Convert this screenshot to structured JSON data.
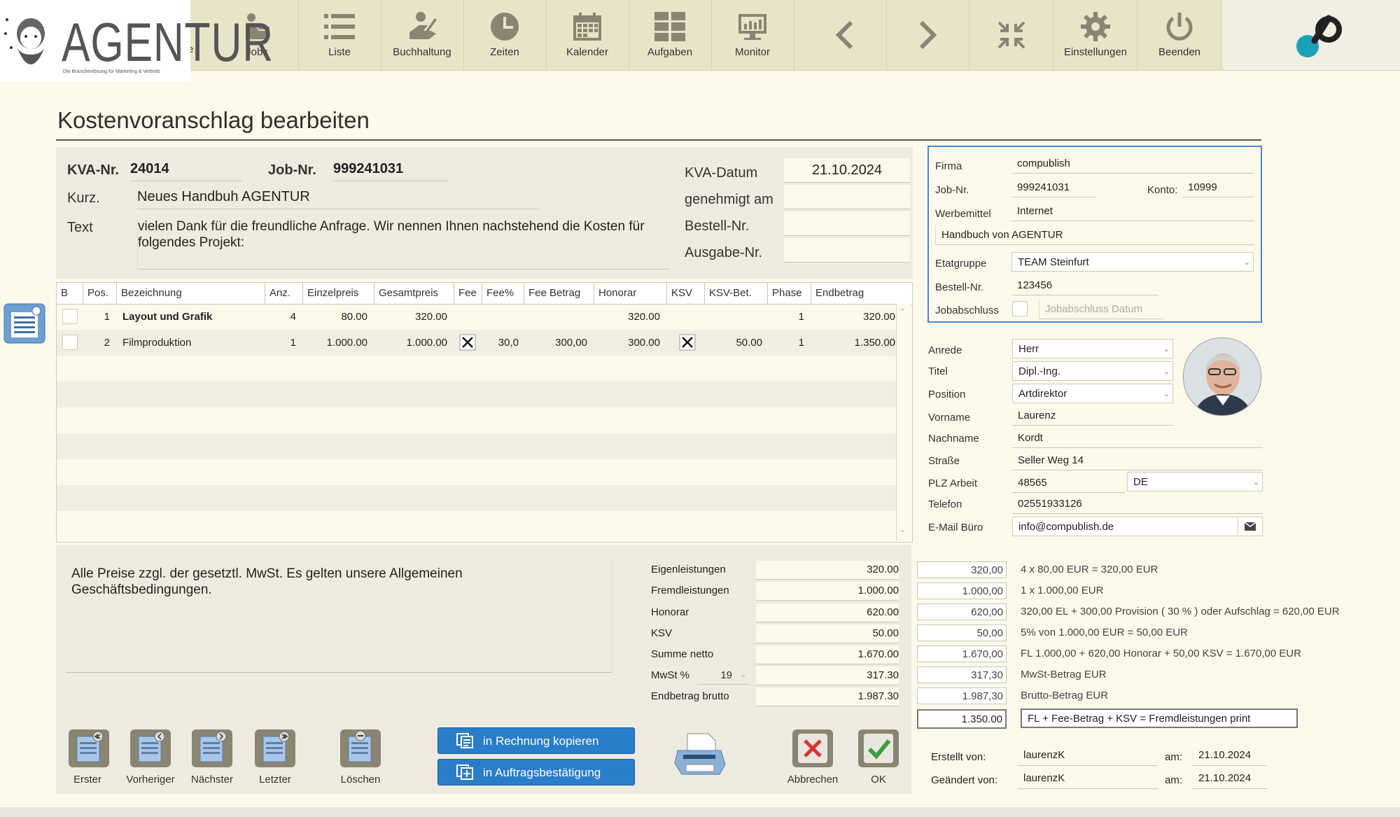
{
  "toolbar": {
    "items": [
      {
        "label": "Jobs",
        "icon": "person-desk-icon"
      },
      {
        "label": "Liste",
        "icon": "list-icon"
      },
      {
        "label": "Buchhaltung",
        "icon": "accounting-hand-icon"
      },
      {
        "label": "Zeiten",
        "icon": "clock-icon"
      },
      {
        "label": "Kalender",
        "icon": "calendar-icon"
      },
      {
        "label": "Aufgaben",
        "icon": "tasks-grid-icon"
      },
      {
        "label": "Monitor",
        "icon": "monitor-icon"
      },
      {
        "label": "",
        "icon": "chevron-left-icon"
      },
      {
        "label": "",
        "icon": "chevron-right-icon"
      },
      {
        "label": "",
        "icon": "collapse-icon"
      },
      {
        "label": "Einstellungen",
        "icon": "gear-icon"
      },
      {
        "label": "Beenden",
        "icon": "power-icon"
      }
    ],
    "partial_label": "e"
  },
  "logo": {
    "word": "AGENTUR",
    "tagline": "Die Branchenlösung für Marketing & Vertrieb"
  },
  "page_title": "Kostenvoranschlag bearbeiten",
  "header": {
    "kva_nr_label": "KVA-Nr.",
    "kva_nr": "24014",
    "job_nr_label": "Job-Nr.",
    "job_nr": "999241031",
    "kurz_label": "Kurz.",
    "kurz": "Neues Handbuh AGENTUR",
    "text_label": "Text",
    "text": "vielen Dank für die freundliche Anfrage. Wir nennen Ihnen nachstehend die Kosten für folgendes Projekt:",
    "kva_datum_label": "KVA-Datum",
    "kva_datum": "21.10.2024",
    "genehmigt_label": "genehmigt am",
    "genehmigt": "",
    "bestell_label": "Bestell-Nr.",
    "bestell": "",
    "ausgabe_label": "Ausgabe-Nr.",
    "ausgabe": ""
  },
  "table": {
    "columns": [
      "B",
      "Pos.",
      "Bezeichnung",
      "Anz.",
      "Einzelpreis",
      "Gesamtpreis",
      "Fee",
      "Fee%",
      "Fee Betrag",
      "Honorar",
      "KSV",
      "KSV-Bet.",
      "Phase",
      "Endbetrag"
    ],
    "rows": [
      {
        "pos": "1",
        "bezeichnung": "Layout und Grafik",
        "anz": "4",
        "einzelpreis": "80.00",
        "gesamtpreis": "320.00",
        "fee": false,
        "fee_pct": "",
        "fee_betrag": "",
        "honorar": "320.00",
        "ksv": false,
        "ksv_bet": "",
        "phase": "1",
        "endbetrag": "320.00"
      },
      {
        "pos": "2",
        "bezeichnung": "Filmproduktion",
        "anz": "1",
        "einzelpreis": "1.000.00",
        "gesamtpreis": "1.000.00",
        "fee": true,
        "fee_pct": "30,0",
        "fee_betrag": "300,00",
        "honorar": "300.00",
        "ksv": true,
        "ksv_bet": "50.00",
        "phase": "1",
        "endbetrag": "1.350.00"
      }
    ]
  },
  "footer_note": "Alle Preise zzgl. der gesetztl. MwSt. Es gelten unsere Allgemeinen Geschäftsbedingungen.",
  "sums": {
    "eigen_label": "Eigenleistungen",
    "eigen": "320.00",
    "fremd_label": "Fremdleistungen",
    "fremd": "1.000.00",
    "honorar_label": "Honorar",
    "honorar": "620.00",
    "ksv_label": "KSV",
    "ksv": "50.00",
    "netto_label": "Summe netto",
    "netto": "1.670.00",
    "mwst_label": "MwSt %",
    "mwst_pct": "19",
    "mwst": "317.30",
    "brutto_label": "Endbetrag brutto",
    "brutto": "1.987.30"
  },
  "calc": {
    "rows": [
      {
        "value": "320,00",
        "text": "4 x 80,00 EUR = 320,00 EUR"
      },
      {
        "value": "1.000,00",
        "text": "1 x 1.000,00 EUR"
      },
      {
        "value": "620,00",
        "text": "320,00 EL + 300,00 Provision ( 30 % ) oder Aufschlag = 620,00 EUR"
      },
      {
        "value": "50,00",
        "text": "5% von 1.000,00 EUR = 50,00 EUR"
      },
      {
        "value": "1.670,00",
        "text": "FL 1.000,00 + 620,00 Honorar + 50,00 KSV = 1.670,00 EUR"
      },
      {
        "value": "317,30",
        "text": "MwSt-Betrag EUR"
      },
      {
        "value": "1.987,30",
        "text": "Brutto-Betrag EUR"
      }
    ],
    "print_value": "1.350.00",
    "print_text": "FL + Fee-Betrag + KSV = Fremdleistungen print"
  },
  "company": {
    "firma_label": "Firma",
    "firma": "compublish",
    "jobnr_label": "Job-Nr.",
    "jobnr": "999241031",
    "konto_label": "Konto:",
    "konto": "10999",
    "werbemittel_label": "Werbemittel",
    "werbemittel": "Internet",
    "beschreibung": "Handbuch von AGENTUR",
    "etat_label": "Etatgruppe",
    "etat": "TEAM Steinfurt",
    "bestell_label": "Bestell-Nr.",
    "bestell": "123456",
    "jobabschluss_label": "Jobabschluss",
    "jobabschluss_placeholder": "Jobabschluss Datum"
  },
  "contact": {
    "anrede_label": "Anrede",
    "anrede": "Herr",
    "titel_label": "Titel",
    "titel": "Dipl.-Ing.",
    "position_label": "Position",
    "position": "Artdirektor",
    "vorname_label": "Vorname",
    "vorname": "Laurenz",
    "nachname_label": "Nachname",
    "nachname": "Kordt",
    "strasse_label": "Straße",
    "strasse": "Seller Weg 14",
    "plz_label": "PLZ Arbeit",
    "plz": "48565",
    "land": "DE",
    "telefon_label": "Telefon",
    "telefon": "02551933126",
    "email_label": "E-Mail Büro",
    "email": "info@compublish.de"
  },
  "actions": {
    "erster": "Erster",
    "vorheriger": "Vorheriger",
    "naechster": "Nächster",
    "letzter": "Letzter",
    "loeschen": "Löschen",
    "rechnung": "in Rechnung kopieren",
    "auftrag": "in Auftragsbestätigung",
    "abbrechen": "Abbrechen",
    "ok": "OK"
  },
  "audit": {
    "erstellt_label": "Erstellt von:",
    "erstellt_von": "laurenzK",
    "erstellt_am_label": "am:",
    "erstellt_am": "21.10.2024",
    "geaendert_label": "Geändert von:",
    "geaendert_von": "laurenzK",
    "geaendert_am_label": "am:",
    "geaendert_am": "21.10.2024"
  },
  "colors": {
    "accent": "#2a7dc9",
    "toolbar_bg": "#e8e4c7",
    "page_bg": "#fbf9ea",
    "icon": "#8a8472",
    "focus_border": "#4a86d6"
  }
}
